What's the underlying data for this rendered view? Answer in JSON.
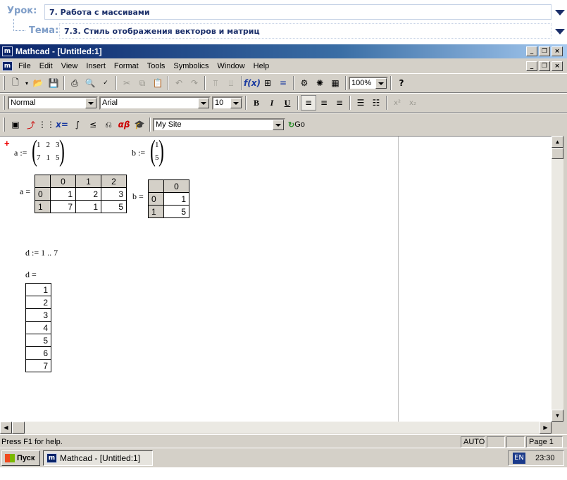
{
  "lesson": {
    "urok_label": "Урок:",
    "urok_value": "7. Работа с массивами",
    "tema_label": "Тема:",
    "tema_value": "7.3. Стиль отображения  векторов и матриц"
  },
  "window": {
    "title": "Mathcad - [Untitled:1]",
    "app_icon": "m",
    "caption_buttons": [
      "_",
      "❐",
      "×"
    ]
  },
  "menu": [
    "File",
    "Edit",
    "View",
    "Insert",
    "Format",
    "Tools",
    "Symbolics",
    "Window",
    "Help"
  ],
  "toolbar": {
    "zoom": "100%",
    "style": "Normal",
    "font": "Arial",
    "size": "10",
    "bold": "B",
    "italic": "I",
    "underline": "U",
    "site": "My Site",
    "go": "Go"
  },
  "worksheet": {
    "a_def_label": "a :=",
    "a_matrix": [
      [
        "1",
        "2",
        "3"
      ],
      [
        "7",
        "1",
        "5"
      ]
    ],
    "b_def_label": "b :=",
    "b_matrix": [
      [
        "1"
      ],
      [
        "5"
      ]
    ],
    "a_eval_label": "a =",
    "a_table": {
      "col_headers": [
        "0",
        "1",
        "2"
      ],
      "rows": [
        {
          "index": "0",
          "values": [
            "1",
            "2",
            "3"
          ]
        },
        {
          "index": "1",
          "values": [
            "7",
            "1",
            "5"
          ]
        }
      ]
    },
    "b_eval_label": "b =",
    "b_table": {
      "col_headers": [
        "0"
      ],
      "rows": [
        {
          "index": "0",
          "values": [
            "1"
          ]
        },
        {
          "index": "1",
          "values": [
            "5"
          ]
        }
      ]
    },
    "d_def": "d := 1 .. 7",
    "d_eval_label": "d =",
    "d_values": [
      "1",
      "2",
      "3",
      "4",
      "5",
      "6",
      "7"
    ]
  },
  "status": {
    "help": "Press F1 for help.",
    "mode": "AUTO",
    "page": "Page 1"
  },
  "taskbar": {
    "start": "Пуск",
    "task": "Mathcad - [Untitled:1]",
    "lang": "EN",
    "clock": "23:30"
  }
}
